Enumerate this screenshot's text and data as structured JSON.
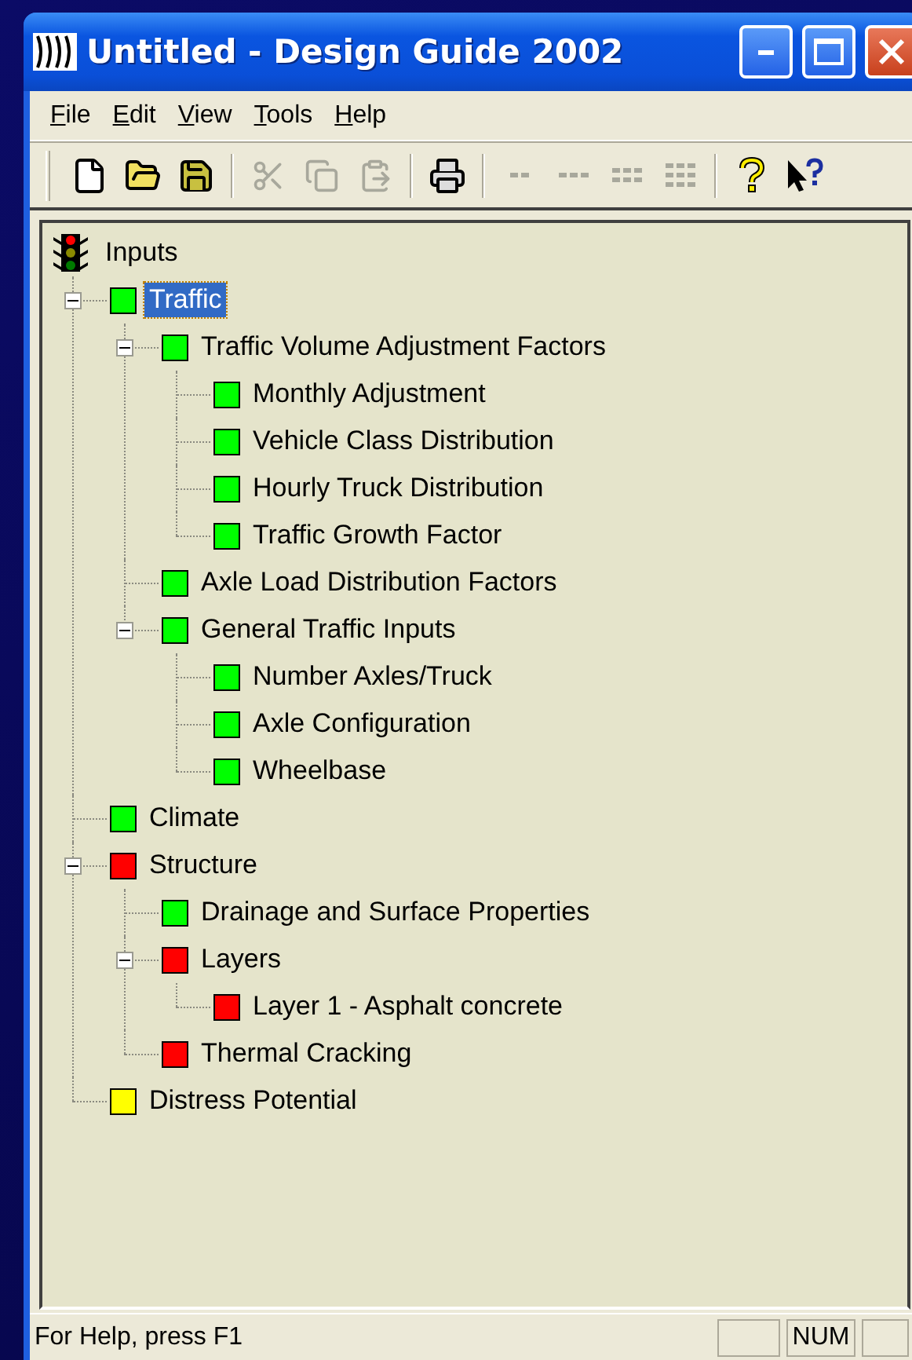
{
  "window": {
    "title": "Untitled - Design Guide 2002"
  },
  "menu": [
    {
      "label": "File"
    },
    {
      "label": "Edit"
    },
    {
      "label": "View"
    },
    {
      "label": "Tools"
    },
    {
      "label": "Help"
    }
  ],
  "toolbar": [
    [
      {
        "kind": "new",
        "disabled": false
      },
      {
        "kind": "open",
        "disabled": false
      },
      {
        "kind": "save",
        "disabled": false
      }
    ],
    [
      {
        "kind": "cut",
        "disabled": true
      },
      {
        "kind": "copy",
        "disabled": true
      },
      {
        "kind": "paste",
        "disabled": true
      }
    ],
    [
      {
        "kind": "print",
        "disabled": false
      }
    ],
    [
      {
        "kind": "tree1",
        "disabled": true
      },
      {
        "kind": "tree2",
        "disabled": true
      },
      {
        "kind": "tree3",
        "disabled": true
      },
      {
        "kind": "tree4",
        "disabled": true
      }
    ],
    [
      {
        "kind": "help",
        "disabled": false
      },
      {
        "kind": "context-help",
        "disabled": false
      }
    ]
  ],
  "tree": {
    "label": "Inputs",
    "children": [
      {
        "label": "Traffic",
        "color": "#00ff00",
        "selected": true,
        "expanded": true,
        "children": [
          {
            "label": "Traffic Volume Adjustment Factors",
            "color": "#00ff00",
            "selected": false,
            "expanded": true,
            "children": [
              {
                "label": "Monthly Adjustment",
                "color": "#00ff00",
                "selected": false
              },
              {
                "label": "Vehicle Class Distribution",
                "color": "#00ff00",
                "selected": false
              },
              {
                "label": "Hourly Truck Distribution",
                "color": "#00ff00",
                "selected": false
              },
              {
                "label": "Traffic Growth Factor",
                "color": "#00ff00",
                "selected": false
              }
            ]
          },
          {
            "label": "Axle Load Distribution Factors",
            "color": "#00ff00",
            "selected": false
          },
          {
            "label": "General Traffic Inputs",
            "color": "#00ff00",
            "selected": false,
            "expanded": true,
            "children": [
              {
                "label": "Number Axles/Truck",
                "color": "#00ff00",
                "selected": false
              },
              {
                "label": "Axle Configuration",
                "color": "#00ff00",
                "selected": false
              },
              {
                "label": "Wheelbase",
                "color": "#00ff00",
                "selected": false
              }
            ]
          }
        ]
      },
      {
        "label": "Climate",
        "color": "#00ff00",
        "selected": false
      },
      {
        "label": "Structure",
        "color": "#ff0000",
        "selected": false,
        "expanded": true,
        "children": [
          {
            "label": "Drainage and Surface Properties",
            "color": "#00ff00",
            "selected": false
          },
          {
            "label": "Layers",
            "color": "#ff0000",
            "selected": false,
            "expanded": true,
            "children": [
              {
                "label": "Layer 1 - Asphalt concrete",
                "color": "#ff0000",
                "selected": false
              }
            ]
          },
          {
            "label": "Thermal Cracking",
            "color": "#ff0000",
            "selected": false
          }
        ]
      },
      {
        "label": "Distress Potential",
        "color": "#ffff00",
        "selected": false
      }
    ]
  },
  "status_bar": {
    "message": "For Help, press F1",
    "indicator": "NUM"
  }
}
